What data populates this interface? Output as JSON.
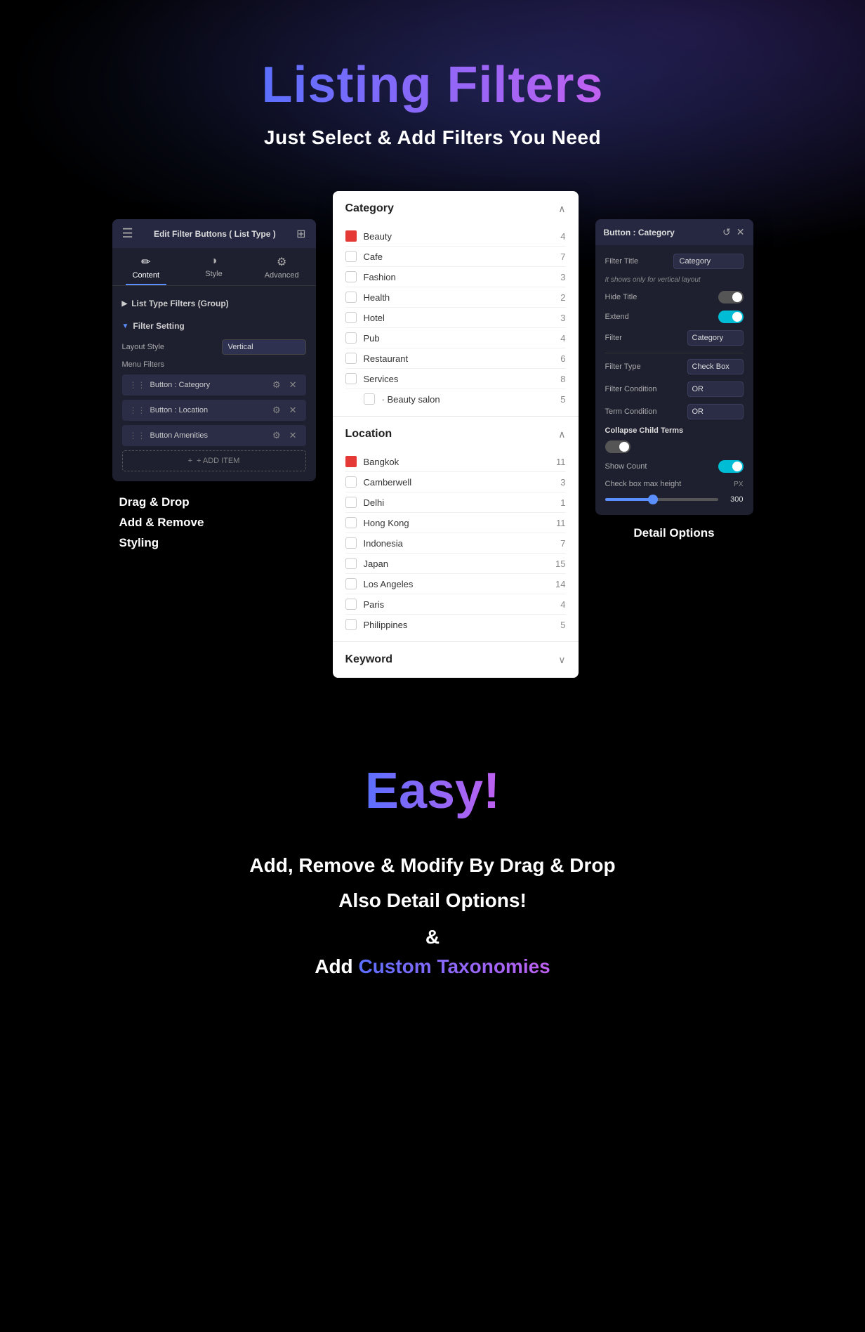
{
  "page": {
    "title": "Listing Filters",
    "subtitle": "Just Select & Add Filters You Need",
    "easy_title": "Easy!",
    "bottom_lines": [
      "Add, Remove & Modify By Drag & Drop",
      "Also Detail Options!",
      "&",
      "Add"
    ],
    "custom_taxonomies": "Custom Taxonomies"
  },
  "left_panel": {
    "header_title": "Edit Filter Buttons ( List Type )",
    "tabs": [
      {
        "label": "Content",
        "icon": "✏️",
        "active": true
      },
      {
        "label": "Style",
        "icon": "🎨",
        "active": false
      },
      {
        "label": "Advanced",
        "icon": "⚙️",
        "active": false
      }
    ],
    "group_label": "List Type Filters (Group)",
    "filter_setting_label": "Filter Setting",
    "layout_label": "Layout Style",
    "layout_value": "Vertical",
    "menu_filters_label": "Menu Filters",
    "filter_items": [
      {
        "label": "Button : Category"
      },
      {
        "label": "Button : Location"
      },
      {
        "label": "Button Amenities"
      }
    ],
    "add_item_label": "+ ADD ITEM",
    "drag_drop_text": "Drag & Drop\nAdd & Remove\nStyling"
  },
  "center_panel": {
    "groups": [
      {
        "title": "Category",
        "expanded": true,
        "items": [
          {
            "name": "Beauty",
            "count": 4,
            "checked": true,
            "color": "#e53935"
          },
          {
            "name": "Cafe",
            "count": 7,
            "checked": false
          },
          {
            "name": "Fashion",
            "count": 3,
            "checked": false
          },
          {
            "name": "Health",
            "count": 2,
            "checked": false
          },
          {
            "name": "Hotel",
            "count": 3,
            "checked": false
          },
          {
            "name": "Pub",
            "count": 4,
            "checked": false
          },
          {
            "name": "Restaurant",
            "count": 6,
            "checked": false
          },
          {
            "name": "Services",
            "count": 8,
            "checked": false
          },
          {
            "name": "· Beauty salon",
            "count": 5,
            "checked": false,
            "indent": true
          }
        ]
      },
      {
        "title": "Location",
        "expanded": true,
        "items": [
          {
            "name": "Bangkok",
            "count": 11,
            "checked": true,
            "color": "#e53935"
          },
          {
            "name": "Camberwell",
            "count": 3,
            "checked": false
          },
          {
            "name": "Delhi",
            "count": 1,
            "checked": false
          },
          {
            "name": "Hong Kong",
            "count": 11,
            "checked": false
          },
          {
            "name": "Indonesia",
            "count": 7,
            "checked": false
          },
          {
            "name": "Japan",
            "count": 15,
            "checked": false
          },
          {
            "name": "Los Angeles",
            "count": 14,
            "checked": false
          },
          {
            "name": "Paris",
            "count": 4,
            "checked": false
          },
          {
            "name": "Philippines",
            "count": 5,
            "checked": false
          }
        ]
      },
      {
        "title": "Keyword",
        "expanded": false,
        "items": []
      }
    ]
  },
  "right_panel": {
    "header_title": "Button : Category",
    "filter_title_label": "Filter Title",
    "filter_title_value": "Category",
    "hint_text": "It shows only for vertical layout",
    "hide_title_label": "Hide Title",
    "hide_title_on": false,
    "extend_label": "Extend",
    "extend_on": true,
    "filter_label": "Filter",
    "filter_value": "Category",
    "filter_type_label": "Filter Type",
    "filter_type_value": "Check Box",
    "filter_condition_label": "Filter Condition",
    "filter_condition_value": "OR",
    "term_condition_label": "Term Condition",
    "term_condition_value": "OR",
    "collapse_child_label": "Collapse Child Terms",
    "collapse_on": false,
    "show_count_label": "Show Count",
    "show_count_on": true,
    "check_box_max_height_label": "Check box max height",
    "slider_value": "300",
    "slider_unit": "PX",
    "detail_options_label": "Detail Options"
  }
}
